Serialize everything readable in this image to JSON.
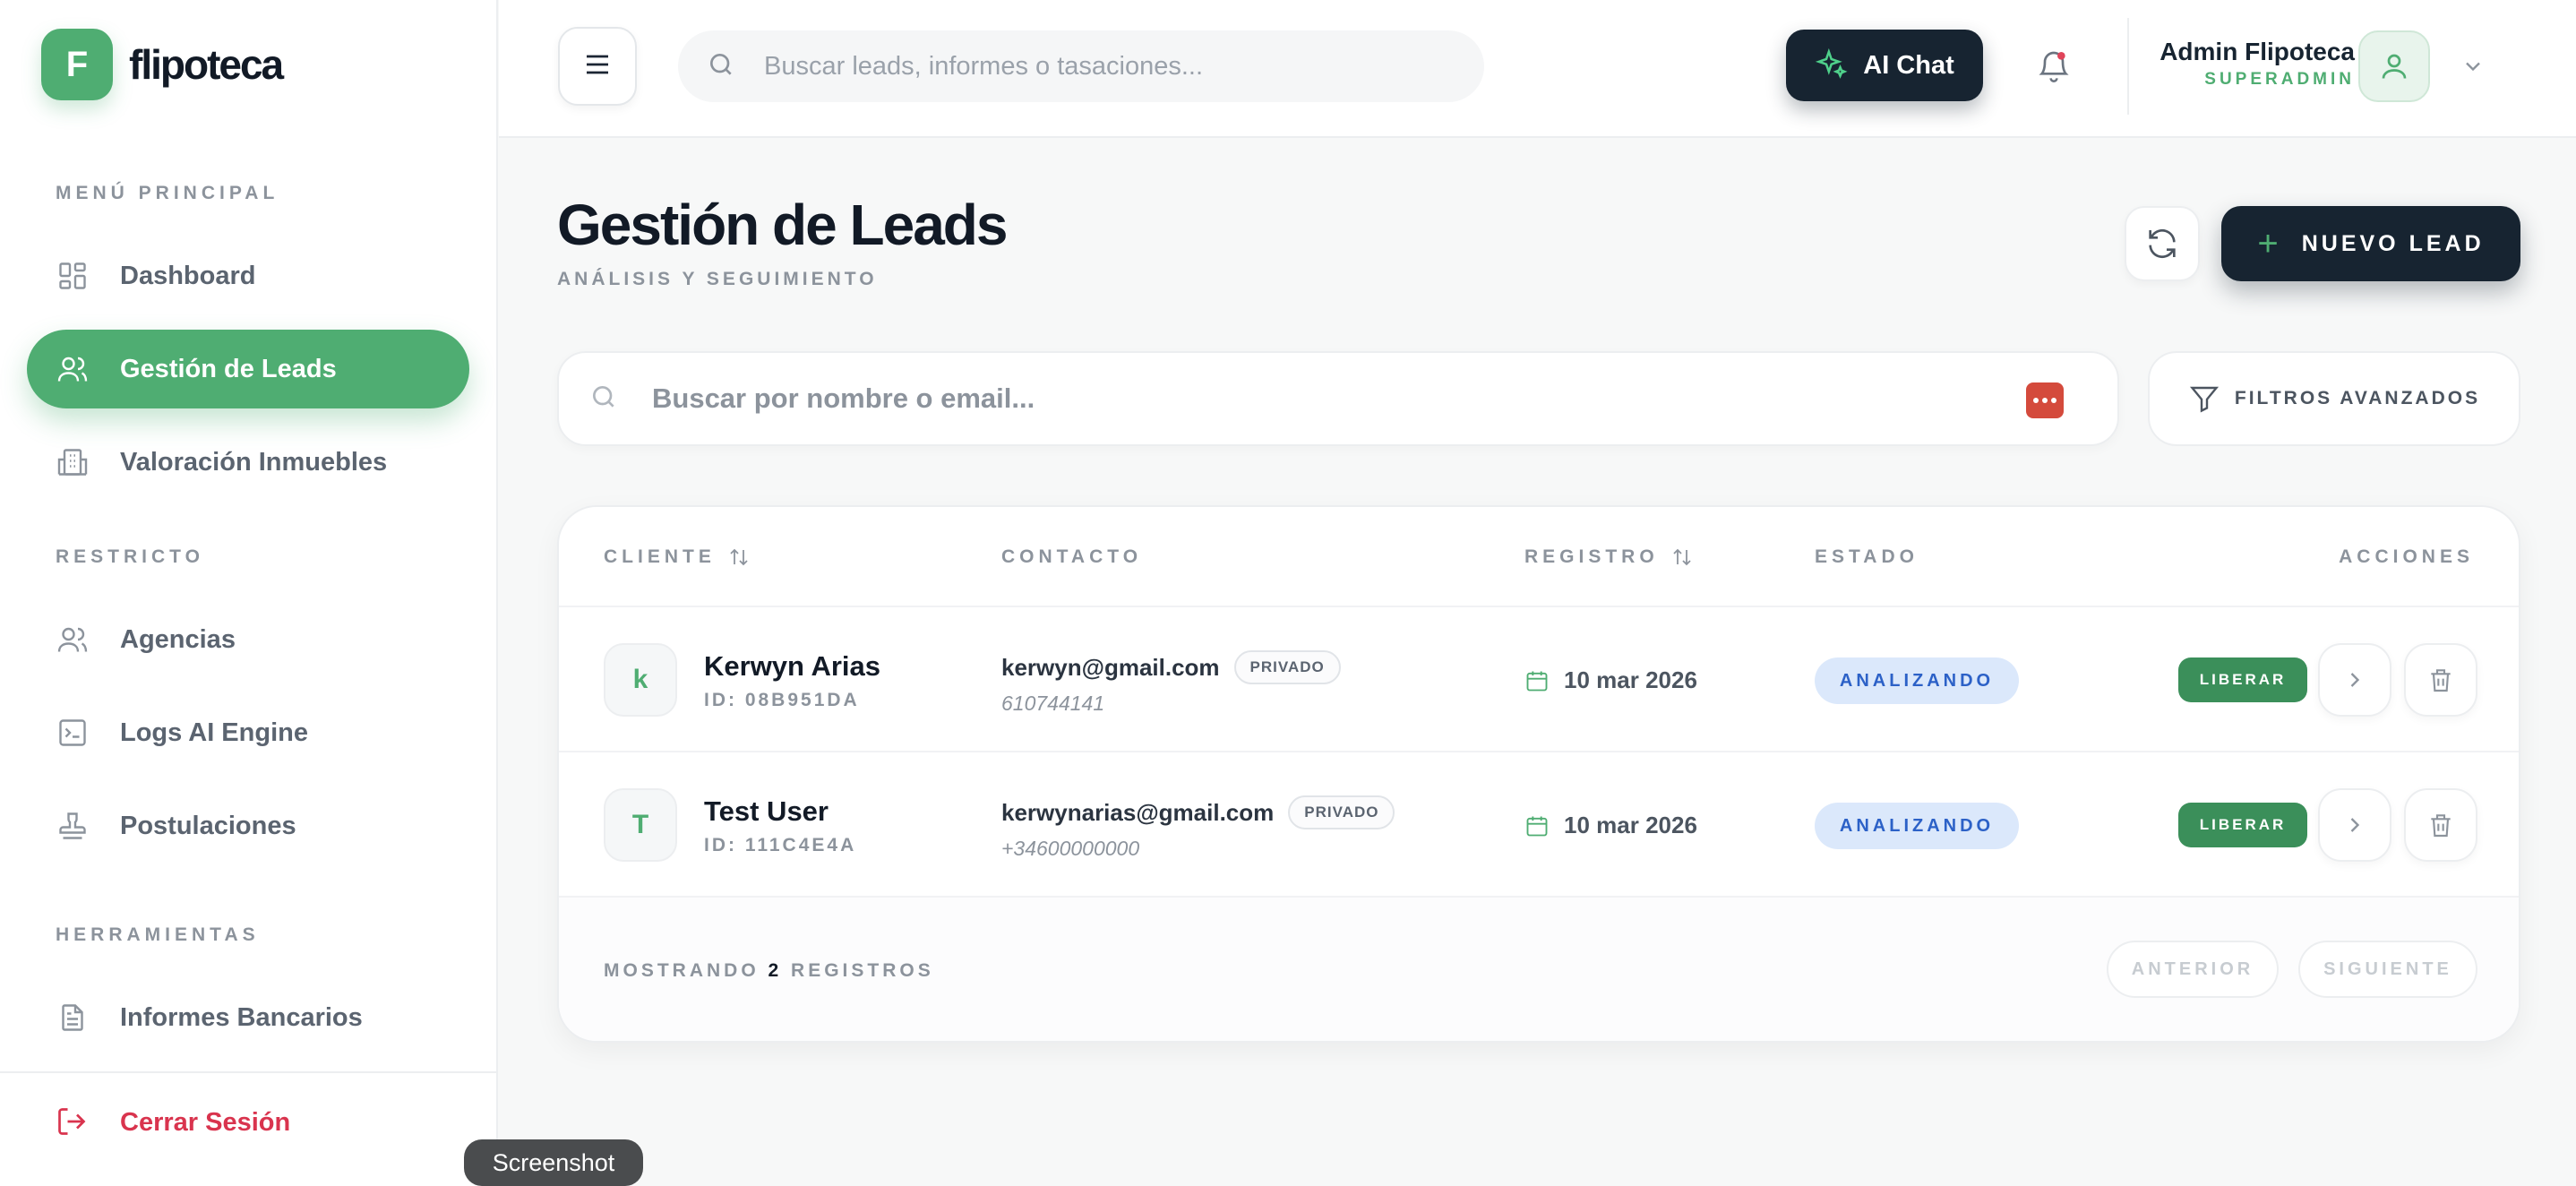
{
  "brand": {
    "initial": "F",
    "name": "flipoteca",
    "accent": "#4fad72"
  },
  "sidebar": {
    "sections": [
      {
        "title": "MENÚ PRINCIPAL"
      },
      {
        "title": "RESTRICTO"
      },
      {
        "title": "HERRAMIENTAS"
      }
    ],
    "items": [
      {
        "label": "Dashboard",
        "icon": "dashboard-icon"
      },
      {
        "label": "Gestión de Leads",
        "icon": "users-icon",
        "active": true
      },
      {
        "label": "Valoración Inmuebles",
        "icon": "building-icon"
      },
      {
        "label": "Agencias",
        "icon": "users-icon"
      },
      {
        "label": "Logs AI Engine",
        "icon": "terminal-icon"
      },
      {
        "label": "Postulaciones",
        "icon": "stamp-icon"
      },
      {
        "label": "Informes Bancarios",
        "icon": "document-icon"
      }
    ],
    "logout_label": "Cerrar Sesión"
  },
  "topbar": {
    "search_placeholder": "Buscar leads, informes o tasaciones...",
    "ai_chat_label": "AI Chat",
    "user_name": "Admin Flipoteca",
    "user_role": "SUPERADMIN"
  },
  "main": {
    "title": "Gestión de Leads",
    "subtitle": "ANÁLISIS Y SEGUIMIENTO",
    "new_lead_label": "NUEVO LEAD",
    "search_placeholder": "Buscar por nombre o email...",
    "filters_label": "FILTROS AVANZADOS"
  },
  "table": {
    "columns": [
      "CLIENTE",
      "CONTACTO",
      "REGISTRO",
      "ESTADO",
      "ACCIONES"
    ],
    "rows": [
      {
        "initial": "k",
        "name": "Kerwyn Arias",
        "id": "ID: 08B951DA",
        "email": "kerwyn@gmail.com",
        "type": "PRIVADO",
        "phone": "610744141",
        "date": "10 mar 2026",
        "status": "ANALIZANDO",
        "action": "LIBERAR"
      },
      {
        "initial": "T",
        "name": "Test User",
        "id": "ID: 111C4E4A",
        "email": "kerwynarias@gmail.com",
        "type": "PRIVADO",
        "phone": "+34600000000",
        "date": "10 mar 2026",
        "status": "ANALIZANDO",
        "action": "LIBERAR"
      }
    ],
    "footer": {
      "prefix": "MOSTRANDO",
      "count": "2",
      "suffix": "REGISTROS",
      "prev": "ANTERIOR",
      "next": "SIGUIENTE"
    }
  },
  "tooltip": "Screenshot"
}
